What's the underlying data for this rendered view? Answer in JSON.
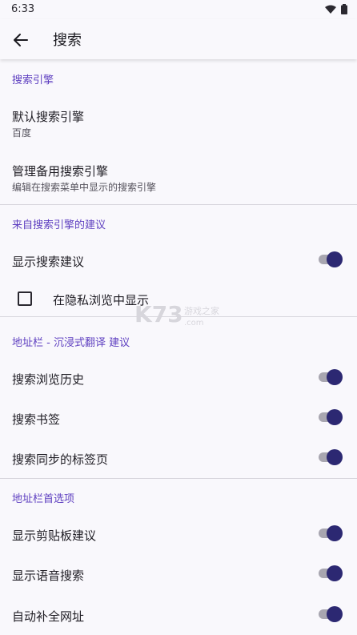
{
  "status": {
    "time": "6:33"
  },
  "header": {
    "title": "搜索"
  },
  "sections": {
    "engine": {
      "header": "搜索引擎",
      "default_title": "默认搜索引擎",
      "default_value": "百度",
      "manage_title": "管理备用搜索引擎",
      "manage_sub": "编辑在搜索菜单中显示的搜索引擎"
    },
    "suggest": {
      "header": "来自搜索引擎的建议",
      "show_suggest": "显示搜索建议",
      "private": "在隐私浏览中显示"
    },
    "addressbar": {
      "header": "地址栏 - 沉浸式翻译 建议",
      "history": "搜索浏览历史",
      "bookmarks": "搜索书签",
      "synced_tabs": "搜索同步的标签页"
    },
    "prefs": {
      "header": "地址栏首选项",
      "clipboard": "显示剪贴板建议",
      "voice": "显示语音搜索",
      "autocomplete": "自动补全网址"
    }
  },
  "toggles": {
    "show_suggest": true,
    "history": true,
    "bookmarks": true,
    "synced_tabs": true,
    "clipboard": true,
    "voice": true,
    "autocomplete": true
  },
  "checkbox": {
    "private": false
  },
  "watermark": {
    "logo": "K73",
    "text": "游戏之家",
    "domain": ".com"
  },
  "colors": {
    "accent": "#5e3fc0",
    "toggle_thumb": "#2c2872",
    "background": "#f9f8fc"
  }
}
